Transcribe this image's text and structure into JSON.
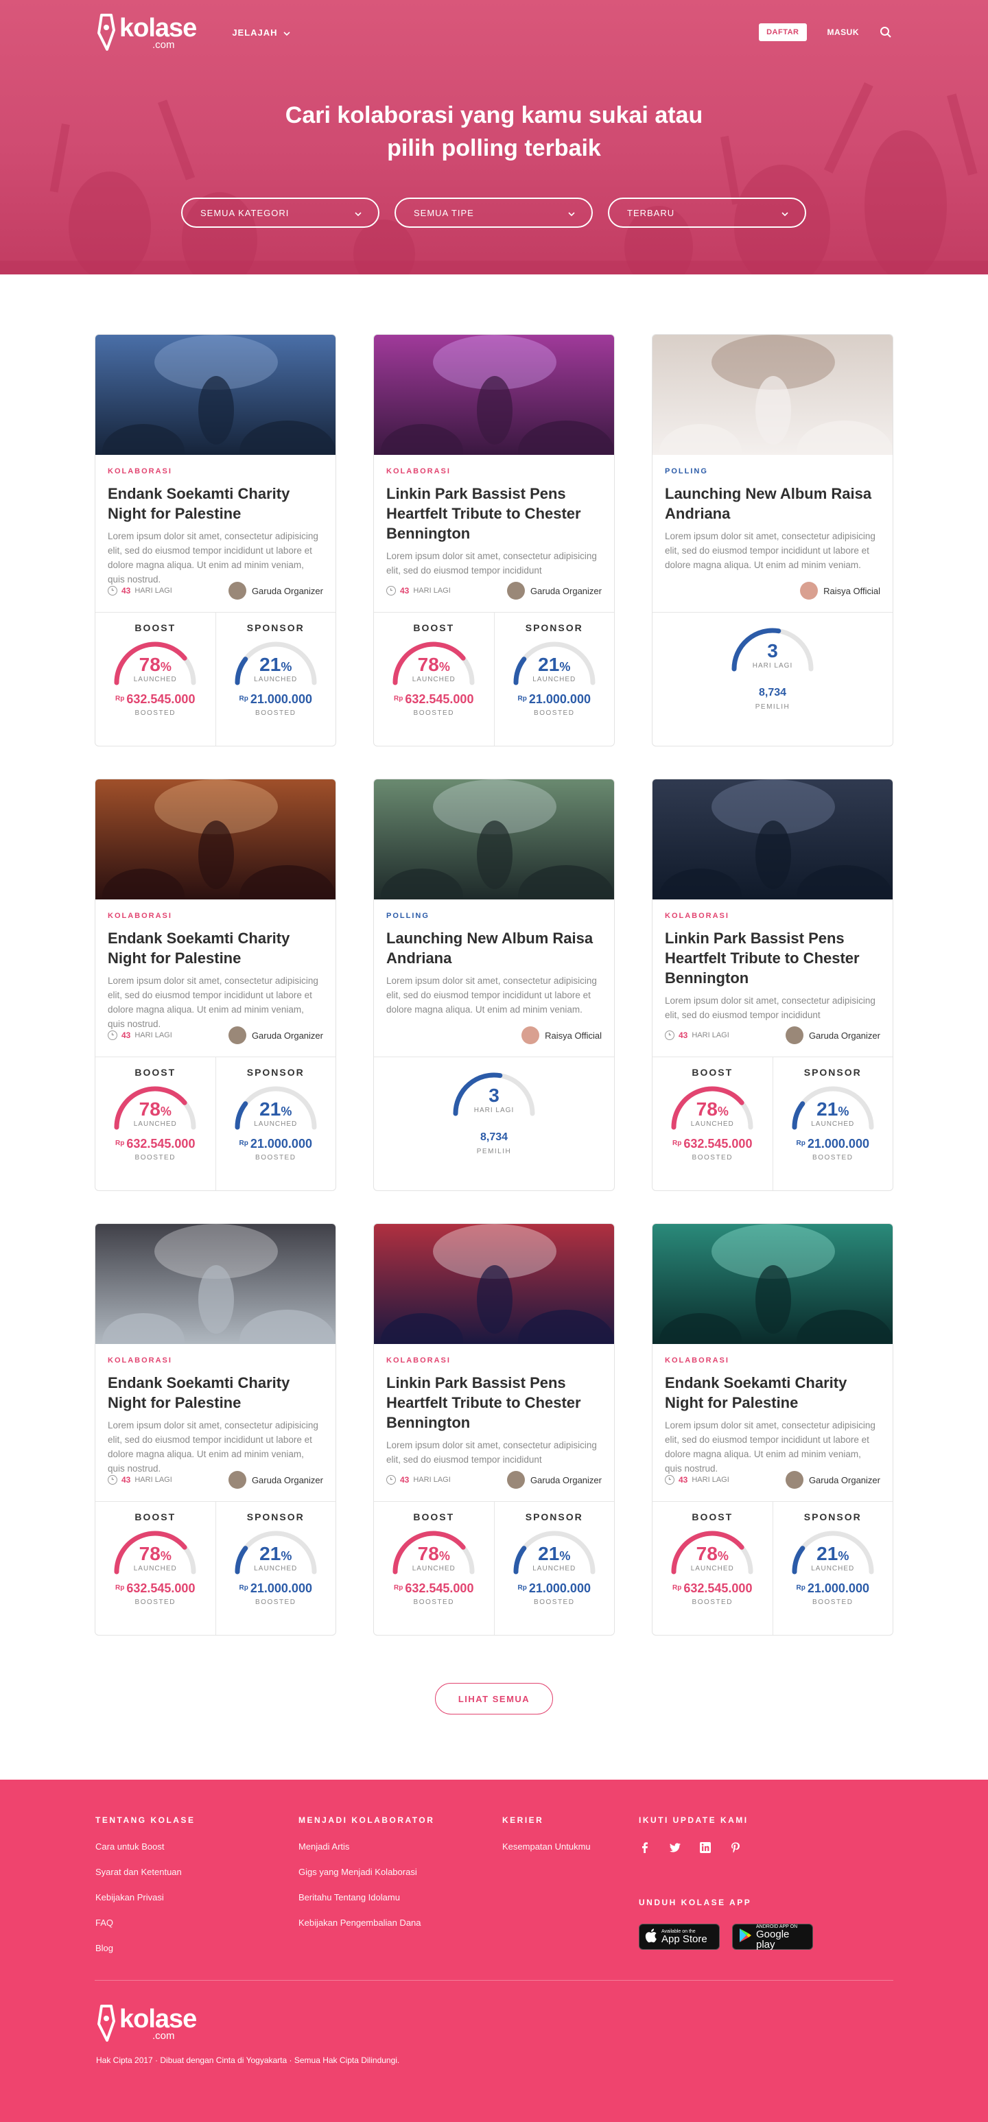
{
  "nav": {
    "logo_text": "kolase",
    "logo_sub": ".com",
    "explore_label": "JELAJAH",
    "register_label": "DAFTAR",
    "login_label": "MASUK"
  },
  "hero": {
    "title_line1": "Cari kolaborasi yang kamu sukai atau",
    "title_line2": "pilih polling terbaik",
    "filters": [
      "SEMUA KATEGORI",
      "SEMUA TIPE",
      "TERBARU"
    ]
  },
  "colors": {
    "brand_pink": "#e24470",
    "footer_pink": "#ef446e",
    "accent_blue": "#2b5ba8"
  },
  "cards": [
    {
      "type": "kolaborasi",
      "category": "KOLABORASI",
      "title": "Endank Soekamti Charity Night for Palestine",
      "desc": "Lorem ipsum dolor sit amet, consectetur adipisicing elit, sed do eiusmod tempor incididunt ut labore et dolore magna aliqua. Ut enim ad minim veniam, quis nostrud.",
      "days": "43",
      "days_label": "HARI LAGI",
      "organizer": "Garuda Organizer",
      "boost_label": "BOOST",
      "boost_pct": "78",
      "launched": "LAUNCHED",
      "boost_amount": "632.545.000",
      "sponsor_label": "SPONSOR",
      "sponsor_pct": "21",
      "sponsor_amount": "21.000.000",
      "boosted": "BOOSTED",
      "rp": "Rp"
    },
    {
      "type": "kolaborasi",
      "category": "KOLABORASI",
      "title": "Linkin Park Bassist Pens Heartfelt Tribute to Chester Bennington",
      "desc": "Lorem ipsum dolor sit amet, consectetur adipisicing elit, sed do eiusmod tempor incididunt",
      "days": "43",
      "days_label": "HARI LAGI",
      "organizer": "Garuda Organizer",
      "boost_label": "BOOST",
      "boost_pct": "78",
      "launched": "LAUNCHED",
      "boost_amount": "632.545.000",
      "sponsor_label": "SPONSOR",
      "sponsor_pct": "21",
      "sponsor_amount": "21.000.000",
      "boosted": "BOOSTED",
      "rp": "Rp"
    },
    {
      "type": "polling",
      "category": "POLLING",
      "title": "Launching New Album Raisa Andriana",
      "desc": "Lorem ipsum dolor sit amet, consectetur adipisicing elit, sed do eiusmod tempor incididunt ut labore et dolore magna aliqua. Ut enim ad minim veniam.",
      "organizer": "Raisya Official",
      "poll_days": "3",
      "days_label": "HARI LAGI",
      "votes": "8,734",
      "voters_label": "PEMILIH"
    },
    {
      "type": "kolaborasi",
      "category": "KOLABORASI",
      "title": "Endank Soekamti Charity Night for Palestine",
      "desc": "Lorem ipsum dolor sit amet, consectetur adipisicing elit, sed do eiusmod tempor incididunt ut labore et dolore magna aliqua. Ut enim ad minim veniam, quis nostrud.",
      "days": "43",
      "days_label": "HARI LAGI",
      "organizer": "Garuda Organizer",
      "boost_label": "BOOST",
      "boost_pct": "78",
      "launched": "LAUNCHED",
      "boost_amount": "632.545.000",
      "sponsor_label": "SPONSOR",
      "sponsor_pct": "21",
      "sponsor_amount": "21.000.000",
      "boosted": "BOOSTED",
      "rp": "Rp"
    },
    {
      "type": "polling",
      "category": "POLLING",
      "title": "Launching New Album Raisa Andriana",
      "desc": "Lorem ipsum dolor sit amet, consectetur adipisicing elit, sed do eiusmod tempor incididunt ut labore et dolore magna aliqua. Ut enim ad minim veniam.",
      "organizer": "Raisya Official",
      "poll_days": "3",
      "days_label": "HARI LAGI",
      "votes": "8,734",
      "voters_label": "PEMILIH"
    },
    {
      "type": "kolaborasi",
      "category": "KOLABORASI",
      "title": "Linkin Park Bassist Pens Heartfelt Tribute to Chester Bennington",
      "desc": "Lorem ipsum dolor sit amet, consectetur adipisicing elit, sed do eiusmod tempor incididunt",
      "days": "43",
      "days_label": "HARI LAGI",
      "organizer": "Garuda Organizer",
      "boost_label": "BOOST",
      "boost_pct": "78",
      "launched": "LAUNCHED",
      "boost_amount": "632.545.000",
      "sponsor_label": "SPONSOR",
      "sponsor_pct": "21",
      "sponsor_amount": "21.000.000",
      "boosted": "BOOSTED",
      "rp": "Rp"
    },
    {
      "type": "kolaborasi",
      "category": "KOLABORASI",
      "title": "Endank Soekamti Charity Night for Palestine",
      "desc": "Lorem ipsum dolor sit amet, consectetur adipisicing elit, sed do eiusmod tempor incididunt ut labore et dolore magna aliqua. Ut enim ad minim veniam, quis nostrud.",
      "days": "43",
      "days_label": "HARI LAGI",
      "organizer": "Garuda Organizer",
      "boost_label": "BOOST",
      "boost_pct": "78",
      "launched": "LAUNCHED",
      "boost_amount": "632.545.000",
      "sponsor_label": "SPONSOR",
      "sponsor_pct": "21",
      "sponsor_amount": "21.000.000",
      "boosted": "BOOSTED",
      "rp": "Rp"
    },
    {
      "type": "kolaborasi",
      "category": "KOLABORASI",
      "title": "Linkin Park Bassist Pens Heartfelt Tribute to Chester Bennington",
      "desc": "Lorem ipsum dolor sit amet, consectetur adipisicing elit, sed do eiusmod tempor incididunt",
      "days": "43",
      "days_label": "HARI LAGI",
      "organizer": "Garuda Organizer",
      "boost_label": "BOOST",
      "boost_pct": "78",
      "launched": "LAUNCHED",
      "boost_amount": "632.545.000",
      "sponsor_label": "SPONSOR",
      "sponsor_pct": "21",
      "sponsor_amount": "21.000.000",
      "boosted": "BOOSTED",
      "rp": "Rp"
    },
    {
      "type": "kolaborasi",
      "category": "KOLABORASI",
      "title": "Endank Soekamti Charity Night for Palestine",
      "desc": "Lorem ipsum dolor sit amet, consectetur adipisicing elit, sed do eiusmod tempor incididunt ut labore et dolore magna aliqua. Ut enim ad minim veniam, quis nostrud.",
      "days": "43",
      "days_label": "HARI LAGI",
      "organizer": "Garuda Organizer",
      "boost_label": "BOOST",
      "boost_pct": "78",
      "launched": "LAUNCHED",
      "boost_amount": "632.545.000",
      "sponsor_label": "SPONSOR",
      "sponsor_pct": "21",
      "sponsor_amount": "21.000.000",
      "boosted": "BOOSTED",
      "rp": "Rp"
    }
  ],
  "see_all_label": "LIHAT SEMUA",
  "footer": {
    "about_title": "TENTANG KOLASE",
    "about_links": [
      "Cara untuk Boost",
      "Syarat dan Ketentuan",
      "Kebijakan Privasi",
      "FAQ",
      "Blog"
    ],
    "collab_title": "MENJADI KOLABORATOR",
    "collab_links": [
      "Menjadi Artis",
      "Gigs yang Menjadi Kolaborasi",
      "Beritahu Tentang Idolamu",
      "Kebijakan Pengembalian Dana"
    ],
    "career_title": "KERIER",
    "career_links": [
      "Kesempatan Untukmu"
    ],
    "follow_title": "IKUTI UPDATE KAMI",
    "download_title": "UNDUH KOLASE APP",
    "appstore_small": "Available on the",
    "appstore_big": "App Store",
    "googleplay_small": "ANDROID APP ON",
    "googleplay_big": "Google play",
    "copyright": "Hak Cipta 2017 · Dibuat dengan Cinta di Yogyakarta · Semua Hak Cipta Dilindungi."
  }
}
